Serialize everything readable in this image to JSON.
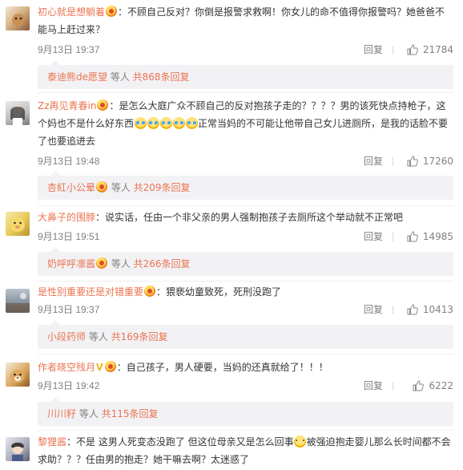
{
  "comments": [
    {
      "username": "初心就是想躺着",
      "text": "：不顾自己反对？你倒是报警求救啊！你女儿的命不值得你报警吗？她爸爸不能马上赶过来？",
      "time": "9月13日 19:37",
      "reply_label": "回复",
      "likes": "21784",
      "sub": {
        "name": "泰迪熊de愿望",
        "middle": " 等人 ",
        "link": "共868条回复"
      }
    },
    {
      "username": "Zz再见青春in",
      "text1": "：是怎么大庭广众不顾自己的反对抱孩子走的？？？？男的该死快点持枪子，这个妈也不是什么好东西",
      "text2": "正常当妈的不可能让他带自己女儿进厕所，是我的话脸不要了也要追进去",
      "time": "9月13日 19:48",
      "reply_label": "回复",
      "likes": "17260",
      "sub": {
        "name": "杏紅小公晕",
        "middle": " 等人 ",
        "link": "共209条回复"
      }
    },
    {
      "username": "大鼻子的围脖",
      "text": "：说实话，任由一个非父亲的男人强制抱孩子去厕所这个举动就不正常吧",
      "time": "9月13日 19:51",
      "reply_label": "回复",
      "likes": "14985",
      "sub": {
        "name": "奶呼呼凛酱",
        "middle": " 等人 ",
        "link": "共266条回复"
      }
    },
    {
      "username": "是性别重要还是对错重要",
      "text": "：猥亵幼童致死，死刑没跑了",
      "time": "9月13日 19:37",
      "reply_label": "回复",
      "likes": "10413",
      "sub": {
        "name": "小段药师",
        "middle": " 等人 ",
        "link": "共169条回复"
      }
    },
    {
      "username": "作者晓空残月",
      "text": "：自己孩子，男人硬要，当妈的还真就给了！！！",
      "time": "9月13日 19:42",
      "reply_label": "回复",
      "likes": "6222",
      "sub": {
        "name": "川川籽",
        "middle": " 等人 ",
        "link": "共115条回复"
      }
    },
    {
      "username": "黎狸酱",
      "text1": "：不是 这男人死变态没跑了 但这位母亲又是怎么回事",
      "text2": "被强迫抱走婴儿那么长时间都不会求助？？？任由男的抱走？她干嘛去啊？太迷惑了"
    }
  ],
  "icons": {
    "like": "thumbs-up-icon",
    "badge": "member-badge-icon",
    "verified": "verified-v-icon",
    "emoji_cry": "crying-face-emoji",
    "emoji_think": "thinking-face-emoji"
  },
  "colors": {
    "username": "#eb7350",
    "meta": "#808080",
    "subbox": "#f2f2f5"
  }
}
